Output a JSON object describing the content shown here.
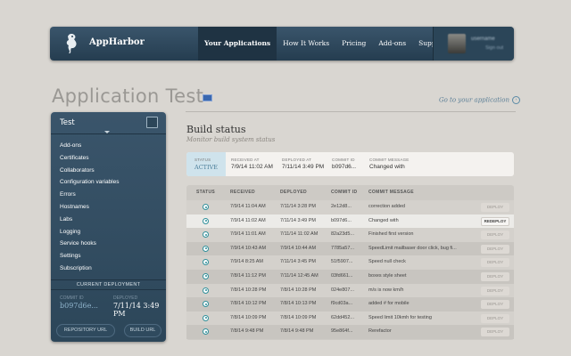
{
  "header": {
    "brand": "AppHarbor",
    "nav": [
      "Your Applications",
      "How It Works",
      "Pricing",
      "Add-ons",
      "Support"
    ],
    "active_nav": "Your Applications",
    "user": {
      "name": "username",
      "action": "Sign out"
    }
  },
  "page": {
    "title": "Application Test",
    "go_link": "Go to your application"
  },
  "sidebar": {
    "title": "Test",
    "items": [
      "Add-ons",
      "Certificates",
      "Collaborators",
      "Configuration variables",
      "Errors",
      "Hostnames",
      "Labs",
      "Logging",
      "Service hooks",
      "Settings",
      "Subscription"
    ],
    "current_deployment": {
      "label": "CURRENT DEPLOYMENT",
      "commit_label": "COMMIT ID",
      "commit_id": "b097d6e...",
      "deployed_label": "DEPLOYED",
      "deployed": "7/11/14 3:49 PM"
    },
    "repo_button": "REPOSITORY URL",
    "build_button": "BUILD URL"
  },
  "build_status": {
    "title": "Build status",
    "subtitle": "Monitor build system status",
    "summary": {
      "status_label": "STATUS",
      "status": "ACTIVE",
      "received_label": "RECEIVED AT",
      "received": "7/9/14 11:02 AM",
      "deployed_label": "DEPLOYED AT",
      "deployed": "7/11/14 3:49 PM",
      "commit_label": "COMMIT ID",
      "commit": "b097d6...",
      "message_label": "COMMIT MESSAGE",
      "message": "Changed with"
    },
    "columns": [
      "STATUS",
      "RECEIVED",
      "DEPLOYED",
      "COMMIT ID",
      "COMMIT MESSAGE"
    ],
    "rows": [
      {
        "received": "7/9/14 11:04 AM",
        "deployed": "7/11/14 3:28 PM",
        "commit": "2e12d8...",
        "message": "correction added",
        "action": "DEPLOY"
      },
      {
        "received": "7/9/14 11:02 AM",
        "deployed": "7/11/14 3:49 PM",
        "commit": "b097d6...",
        "message": "Changed with",
        "action": "REDEPLOY"
      },
      {
        "received": "7/9/14 11:01 AM",
        "deployed": "7/11/14 11:02 AM",
        "commit": "82a23d5...",
        "message": "Finished first version",
        "action": "DEPLOY"
      },
      {
        "received": "7/9/14 10:43 AM",
        "deployed": "7/9/14 10:44 AM",
        "commit": "7785a57...",
        "message": "SpeedLimit mailbaser door click, bug fi...",
        "action": "DEPLOY"
      },
      {
        "received": "7/9/14 8:25 AM",
        "deployed": "7/11/14 3:45 PM",
        "commit": "51f5907...",
        "message": "Speed null check",
        "action": "DEPLOY"
      },
      {
        "received": "7/8/14 11:12 PM",
        "deployed": "7/11/14 12:45 AM",
        "commit": "03fd661...",
        "message": "boxes style sheet",
        "action": "DEPLOY"
      },
      {
        "received": "7/8/14 10:28 PM",
        "deployed": "7/8/14 10:28 PM",
        "commit": "024e807...",
        "message": "m/s is now km/h",
        "action": "DEPLOY"
      },
      {
        "received": "7/8/14 10:12 PM",
        "deployed": "7/8/14 10:13 PM",
        "commit": "f9cd03a...",
        "message": "added # for mobile",
        "action": "DEPLOY"
      },
      {
        "received": "7/8/14 10:09 PM",
        "deployed": "7/8/14 10:09 PM",
        "commit": "62dd452...",
        "message": "Speed limit 10kmh for testing",
        "action": "DEPLOY"
      },
      {
        "received": "7/8/14 9:48 PM",
        "deployed": "7/8/14 9:48 PM",
        "commit": "95e864f...",
        "message": "Rerefactor",
        "action": "DEPLOY"
      }
    ]
  }
}
